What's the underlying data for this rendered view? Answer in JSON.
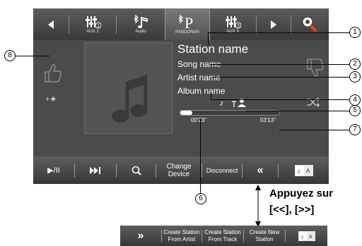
{
  "topbar": {
    "aux1_label": "AUX 1",
    "audio_label": "Audio",
    "pandora_label": "PANDORA®",
    "aux3_label": "AUX 3"
  },
  "track": {
    "station": "Station name",
    "song": "Song name",
    "artist": "Artist name",
    "album": "Album name"
  },
  "playback": {
    "elapsed": "00'23\"",
    "total": "03'13\"",
    "progress": 0.12
  },
  "bottombar": {
    "play_pause": "▶/II",
    "change_device": "Change Device",
    "disconnect": "Disconnect"
  },
  "callouts": [
    "1",
    "2",
    "3",
    "4",
    "5",
    "6",
    "7",
    "8"
  ],
  "hint": {
    "line1": "Appuyez sur",
    "line2": "[<<], [>>]"
  },
  "strip": {
    "from_artist": "Create Station From Artist",
    "from_track": "Create Station From Track",
    "new_station": "Create New Station"
  },
  "colors": {
    "screen_bg": "#4b4b4b",
    "bar_bg": "#3a3a3a",
    "progress": "#ffffff"
  }
}
